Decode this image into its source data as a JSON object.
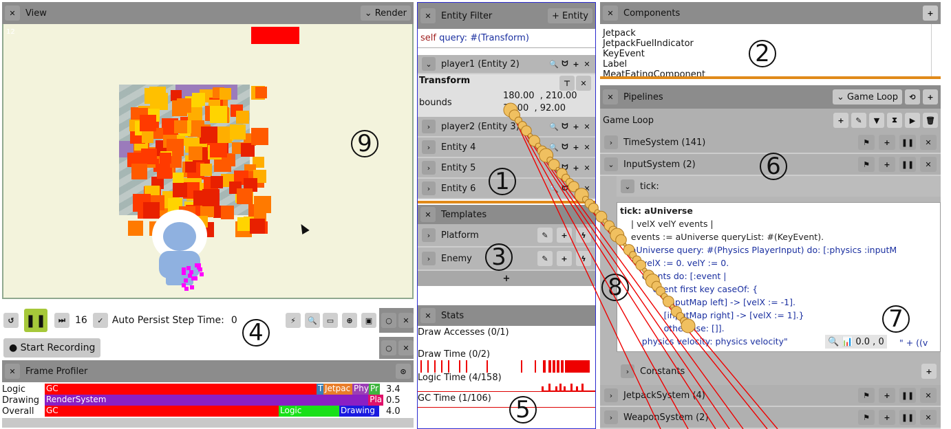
{
  "view": {
    "title": "View",
    "render_label": "Render",
    "corner_text": "12",
    "marker": "9"
  },
  "transport": {
    "frame": "16",
    "auto_persist": "Auto Persist Step Time:",
    "step_time": "0",
    "marker": "4"
  },
  "recording": {
    "label": "Start Recording"
  },
  "profiler": {
    "title": "Frame Profiler",
    "rows": [
      {
        "label": "Logic",
        "value": "3.4",
        "segments": [
          {
            "text": "GC",
            "color": "#ff0000"
          },
          {
            "text": "T",
            "color": "#3b7fb5"
          },
          {
            "text": "Jetpac",
            "color": "#e87d2a"
          },
          {
            "text": "Phy",
            "color": "#9b3fb5"
          },
          {
            "text": "Pr",
            "color": "#3fb53f"
          }
        ]
      },
      {
        "label": "Drawing",
        "value": "0.5",
        "segments": [
          {
            "text": "RenderSystem",
            "color": "#8a1fc4"
          },
          {
            "text": "Pla",
            "color": "#e0106a"
          }
        ]
      },
      {
        "label": "Overall",
        "value": "4.0",
        "segments": [
          {
            "text": "GC",
            "color": "#ff0000"
          },
          {
            "text": "Logic",
            "color": "#19e019"
          },
          {
            "text": "Drawing",
            "color": "#1a1ae0"
          }
        ]
      }
    ]
  },
  "entity_filter": {
    "title": "Entity Filter",
    "add_label": "+ Entity",
    "query_self": "self",
    "query_rest": " query: #(Transform)",
    "marker": "1",
    "player1": "player1 (Entity 2)",
    "transform_label": "Transform",
    "bounds_label": "bounds",
    "bounds_line1": "180.00  , 210.00",
    "bounds_line2": "36.00  , 92.00",
    "entities": [
      "player2 (Entity 3)",
      "Entity 4",
      "Entity 5",
      "Entity 6"
    ]
  },
  "templates": {
    "title": "Templates",
    "items": [
      "Platform",
      "Enemy"
    ],
    "add": "+",
    "marker": "3"
  },
  "stats": {
    "title": "Stats",
    "rows": [
      "Draw Accesses (0/1)",
      "Draw Time (0/2)",
      "Logic Time (4/158)",
      "GC Time (1/106)"
    ],
    "marker": "5"
  },
  "components": {
    "title": "Components",
    "items": [
      "Jetpack",
      "JetpackFuelIndicator",
      "KeyEvent",
      "Label",
      "MeatEatingComponent"
    ],
    "marker": "2"
  },
  "pipelines": {
    "title": "Pipelines",
    "select": "Game Loop",
    "loop_label": "Game Loop",
    "marker": "6",
    "systems_top": [
      "TimeSystem (141)",
      "InputSystem (2)"
    ],
    "tick_label": "tick:",
    "code": [
      "tick: aUniverse",
      "    | velX velY events |",
      "    events := aUniverse queryList: #(KeyEvent).",
      "    aUniverse query: #(Physics PlayerInput) do: [:physics :inputM",
      "        velX := 0. velY := 0.",
      "        events do: [:event |",
      "            event first key caseOf: {",
      "                [inputMap left] -> [velX := -1].",
      "                [inputMap right] -> [velX := 1].}",
      "                otherwise: []].",
      "        physics velocity: physics velocity\" "
    ],
    "inspect_value": "0.0 , 0",
    "code_tail": "\" + ((v",
    "constants": "Constants",
    "systems_bottom": [
      "JetpackSystem (4)",
      "WeaponSystem (2)"
    ],
    "marker7": "7",
    "marker8": "8"
  }
}
